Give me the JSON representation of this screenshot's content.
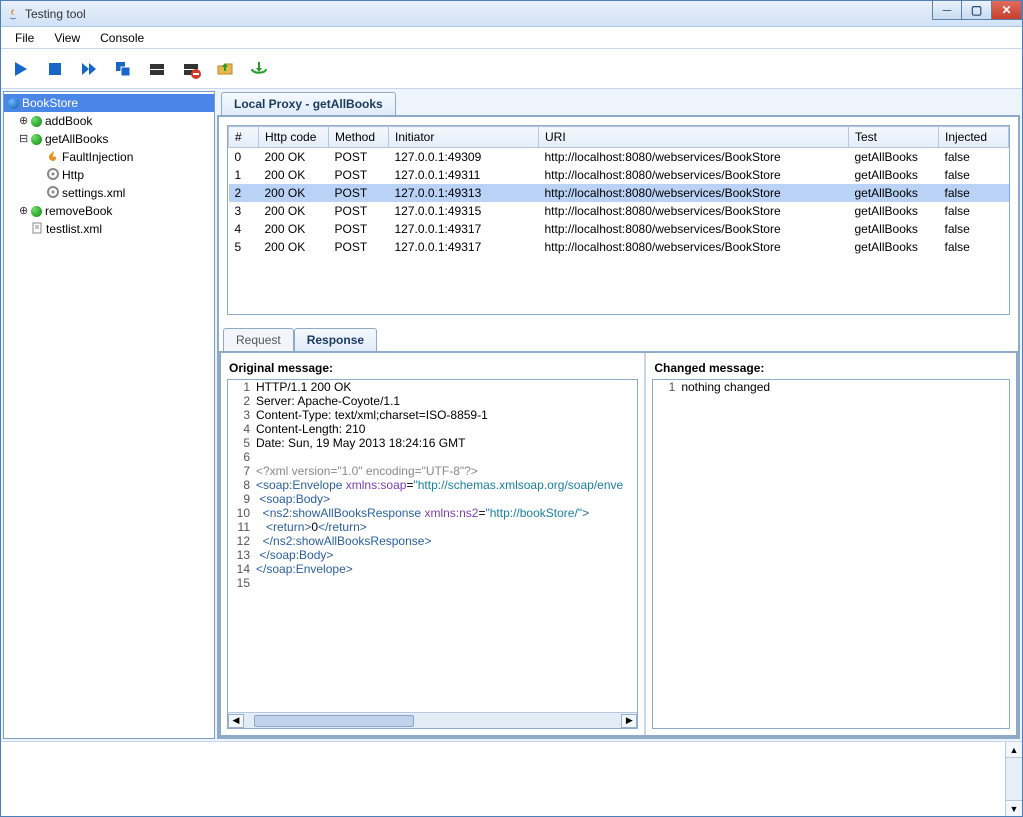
{
  "window": {
    "title": "Testing tool"
  },
  "menu": {
    "file": "File",
    "view": "View",
    "console": "Console"
  },
  "tree": {
    "root": "BookStore",
    "items": [
      {
        "label": "addBook"
      },
      {
        "label": "getAllBooks"
      },
      {
        "label": "FaultInjection"
      },
      {
        "label": "Http"
      },
      {
        "label": "settings.xml"
      },
      {
        "label": "removeBook"
      },
      {
        "label": "testlist.xml"
      }
    ]
  },
  "mainTab": {
    "label": "Local Proxy  - getAllBooks"
  },
  "table": {
    "headers": {
      "num": "#",
      "http": "Http code",
      "method": "Method",
      "initiator": "Initiator",
      "uri": "URI",
      "test": "Test",
      "injected": "Injected"
    },
    "rows": [
      {
        "n": "0",
        "http": "200 OK",
        "method": "POST",
        "initiator": "127.0.0.1:49309",
        "uri": "http://localhost:8080/webservices/BookStore",
        "test": "getAllBooks",
        "inj": "false"
      },
      {
        "n": "1",
        "http": "200 OK",
        "method": "POST",
        "initiator": "127.0.0.1:49311",
        "uri": "http://localhost:8080/webservices/BookStore",
        "test": "getAllBooks",
        "inj": "false"
      },
      {
        "n": "2",
        "http": "200 OK",
        "method": "POST",
        "initiator": "127.0.0.1:49313",
        "uri": "http://localhost:8080/webservices/BookStore",
        "test": "getAllBooks",
        "inj": "false"
      },
      {
        "n": "3",
        "http": "200 OK",
        "method": "POST",
        "initiator": "127.0.0.1:49315",
        "uri": "http://localhost:8080/webservices/BookStore",
        "test": "getAllBooks",
        "inj": "false"
      },
      {
        "n": "4",
        "http": "200 OK",
        "method": "POST",
        "initiator": "127.0.0.1:49317",
        "uri": "http://localhost:8080/webservices/BookStore",
        "test": "getAllBooks",
        "inj": "false"
      },
      {
        "n": "5",
        "http": "200 OK",
        "method": "POST",
        "initiator": "127.0.0.1:49317",
        "uri": "http://localhost:8080/webservices/BookStore",
        "test": "getAllBooks",
        "inj": "false"
      }
    ]
  },
  "detailTabs": {
    "request": "Request",
    "response": "Response"
  },
  "orig": {
    "label": "Original message:",
    "l1": "HTTP/1.1 200 OK",
    "l2": "Server: Apache-Coyote/1.1",
    "l3": "Content-Type: text/xml;charset=ISO-8859-1",
    "l4": "Content-Length: 210",
    "l5": "Date: Sun, 19 May 2013 18:24:16 GMT",
    "l7_pi": "<?xml version=\"1.0\" encoding=\"UTF-8\"?>",
    "l8_a": "<",
    "l8_b": "soap:Envelope",
    "l8_c": " xmlns:soap",
    "l8_d": "=",
    "l8_e": "\"http://schemas.xmlsoap.org/soap/enve",
    "l9_a": " <",
    "l9_b": "soap:Body",
    "l9_c": ">",
    "l10_a": "  <",
    "l10_b": "ns2:showAllBooksResponse",
    "l10_c": " xmlns:ns2",
    "l10_d": "=",
    "l10_e": "\"http://bookStore/\"",
    "l10_f": ">",
    "l11_a": "   <",
    "l11_b": "return",
    "l11_c": ">",
    "l11_d": "0",
    "l11_e": "</",
    "l11_f": "return",
    "l11_g": ">",
    "l12_a": "  </",
    "l12_b": "ns2:showAllBooksResponse",
    "l12_c": ">",
    "l13_a": " </",
    "l13_b": "soap:Body",
    "l13_c": ">",
    "l14_a": "</",
    "l14_b": "soap:Envelope",
    "l14_c": ">"
  },
  "changed": {
    "label": "Changed message:",
    "line1": "nothing changed"
  },
  "gutters": {
    "g1": "1",
    "g2": "2",
    "g3": "3",
    "g4": "4",
    "g5": "5",
    "g6": "6",
    "g7": "7",
    "g8": "8",
    "g9": "9",
    "g10": "10",
    "g11": "11",
    "g12": "12",
    "g13": "13",
    "g14": "14",
    "g15": "15",
    "gc1": "1"
  }
}
